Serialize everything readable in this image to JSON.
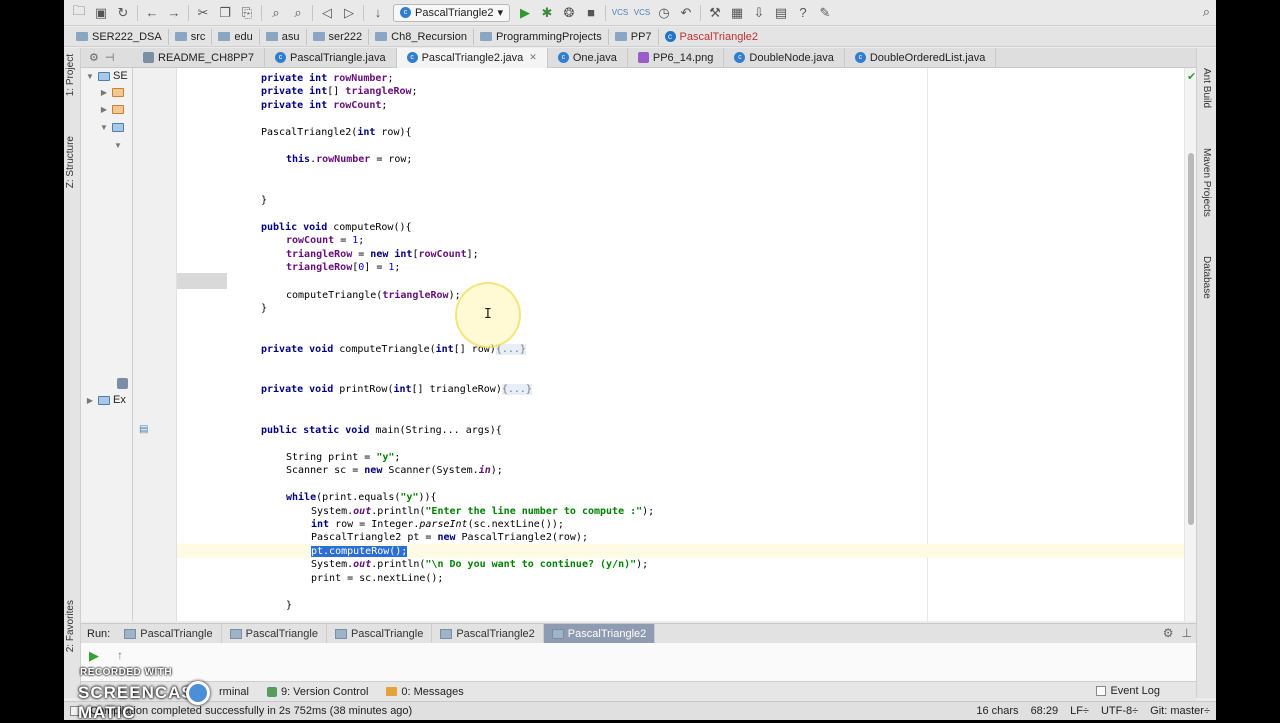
{
  "toolbar": {
    "run_config": "PascalTriangle2",
    "vcs_label_1": "VCS",
    "vcs_label_2": "VCS"
  },
  "breadcrumb": [
    "SER222_DSA",
    "src",
    "edu",
    "asu",
    "ser222",
    "Ch8_Recursion",
    "ProgrammingProjects",
    "PP7",
    "PascalTriangle2"
  ],
  "tabs": [
    {
      "label": "README_CH8PP7",
      "icon": "md"
    },
    {
      "label": "PascalTriangle.java",
      "icon": "c"
    },
    {
      "label": "PascalTriangle2.java",
      "icon": "c",
      "active": true
    },
    {
      "label": "One.java",
      "icon": "c"
    },
    {
      "label": "PP6_14.png",
      "icon": "png"
    },
    {
      "label": "DoubleNode.java",
      "icon": "c"
    },
    {
      "label": "DoubleOrderedList.java",
      "icon": "c"
    }
  ],
  "left_strip": {
    "project": "1: Project",
    "structure": "Z: Structure",
    "favorites": "2: Favorites"
  },
  "project_tree": {
    "root": "SE",
    "external": "Ex"
  },
  "code": {
    "l1_kw": "private int ",
    "l1_fld": "rowNumber",
    "l1_end": ";",
    "l2_kw": "private int",
    "l2_mid": "[] ",
    "l2_fld": "triangleRow",
    "l2_end": ";",
    "l3_kw": "private int ",
    "l3_fld": "rowCount",
    "l3_end": ";",
    "l4": "PascalTriangle2(",
    "l4_kw": "int",
    "l4_end": " row){",
    "l5_kw": "this",
    "l5_dot": ".",
    "l5_fld": "rowNumber",
    "l5_end": " = row;",
    "l6": "}",
    "l7_kw": "public void ",
    "l7_end": "computeRow(){",
    "l8_fld": "rowCount",
    "l8_mid": " = ",
    "l8_num": "1",
    "l8_end": ";",
    "l9_fld": "triangleRow",
    "l9_mid": " = ",
    "l9_kw1": "new int",
    "l9_mid2": "[",
    "l9_fld2": "rowCount",
    "l9_end": "];",
    "l10_fld": "triangleRow",
    "l10_mid": "[",
    "l10_num0": "0",
    "l10_mid2": "] = ",
    "l10_num": "1",
    "l10_end": ";",
    "l11": "computeTriangle(",
    "l11_fld": "triangleRow",
    "l11_end": ");",
    "l12": "}",
    "l13_kw": "private void ",
    "l13_mid": "computeTriangle(",
    "l13_kw2": "int",
    "l13_mid2": "[] row)",
    "l13_fold": "{...}",
    "l14_kw": "private void ",
    "l14_mid": "printRow(",
    "l14_kw2": "int",
    "l14_mid2": "[] triangleRow)",
    "l14_fold": "{...}",
    "l15_kw": "public static void ",
    "l15_end": "main(String... args){",
    "l16_a": "String print = ",
    "l16_str": "\"y\"",
    "l16_end": ";",
    "l17_a": "Scanner sc = ",
    "l17_kw": "new ",
    "l17_b": "Scanner(System.",
    "l17_fld": "in",
    "l17_end": ");",
    "l18_kw": "while",
    "l18_a": "(print.equals(",
    "l18_str": "\"y\"",
    "l18_end": ")){",
    "l19_a": "System.",
    "l19_fld": "out",
    "l19_b": ".println(",
    "l19_str": "\"Enter the line number to compute :\"",
    "l19_end": ");",
    "l20_kw": "int ",
    "l20_a": "row = Integer.",
    "l20_it": "parseInt",
    "l20_end": "(sc.nextLine());",
    "l21_a": "PascalTriangle2 pt = ",
    "l21_kw": "new ",
    "l21_end": "PascalTriangle2(row);",
    "l22_sel": "pt.computeRow();",
    "l23_a": "System.",
    "l23_fld": "out",
    "l23_b": ".println(",
    "l23_str": "\"\\n Do you want to continue? (y/n)\"",
    "l23_end": ");",
    "l24": "print = sc.nextLine();",
    "l25": "}"
  },
  "right_strip": {
    "ant": "Ant Build",
    "maven": "Maven Projects",
    "database": "Database"
  },
  "run": {
    "label": "Run:",
    "tabs": [
      "PascalTriangle",
      "PascalTriangle",
      "PascalTriangle",
      "PascalTriangle2",
      "PascalTriangle2"
    ]
  },
  "bottom_tabs": {
    "terminal": "rminal",
    "version_control": "9: Version Control",
    "messages": "0: Messages",
    "event_log": "Event Log"
  },
  "status": {
    "message": "Compilation completed successfully in 2s 752ms (38 minutes ago)",
    "chars": "16 chars",
    "position": "68:29",
    "line_sep": "LF÷",
    "encoding": "UTF-8÷",
    "git": "Git: master÷"
  },
  "watermark": {
    "top": "RECORDED WITH",
    "main_left": "SCREENCAST",
    "main_right": "MATIC"
  }
}
